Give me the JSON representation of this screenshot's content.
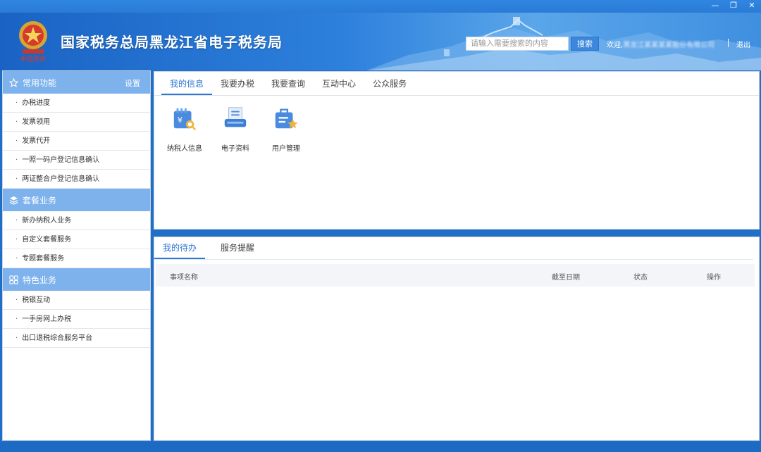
{
  "window": {
    "minimize": "—",
    "restore": "❐",
    "close": "✕"
  },
  "header": {
    "title": "国家税务总局黑龙江省电子税务局",
    "search_placeholder": "请输入需要搜索的内容",
    "search_button": "搜索",
    "welcome_prefix": "欢迎,",
    "welcome_company": "黑龙江某某某某股份有限公司",
    "logout": "退出",
    "emblem_text": "中国税务"
  },
  "sidebar": {
    "sections": [
      {
        "title": "常用功能",
        "setting": "设置",
        "items": [
          "办税进度",
          "发票领用",
          "发票代开",
          "一照一码户登记信息确认",
          "两证整合户登记信息确认"
        ]
      },
      {
        "title": "套餐业务",
        "items": [
          "新办纳税人业务",
          "自定义套餐服务",
          "专题套餐服务"
        ]
      },
      {
        "title": "特色业务",
        "items": [
          "税银互动",
          "一手房网上办税",
          "出口退税综合服务平台"
        ]
      }
    ]
  },
  "main": {
    "tabs": [
      "我的信息",
      "我要办税",
      "我要查询",
      "互动中心",
      "公众服务"
    ],
    "apps": [
      {
        "label": "纳税人信息",
        "icon": "taxpayer-info-icon"
      },
      {
        "label": "电子资料",
        "icon": "e-document-icon"
      },
      {
        "label": "用户管理",
        "icon": "user-management-icon"
      }
    ]
  },
  "todo": {
    "tabs": [
      "我的待办",
      "服务提醒"
    ],
    "columns": [
      "事项名称",
      "截至日期",
      "状态",
      "操作"
    ]
  },
  "colors": {
    "accent": "#2b76d2",
    "sidebar_header": "#7eb2ec",
    "header_blue": "#1a63c4"
  }
}
